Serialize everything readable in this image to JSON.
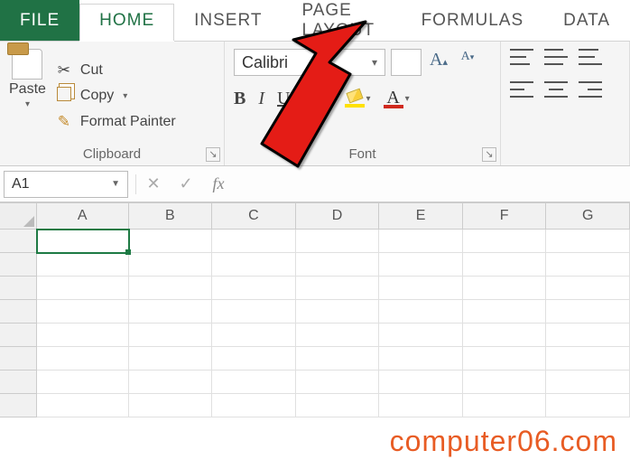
{
  "tabs": {
    "file": "FILE",
    "home": "HOME",
    "insert": "INSERT",
    "page_layout": "PAGE LAYOUT",
    "formulas": "FORMULAS",
    "data": "DATA"
  },
  "clipboard": {
    "paste": "Paste",
    "cut": "Cut",
    "copy": "Copy",
    "format_painter": "Format Painter",
    "group_label": "Clipboard"
  },
  "font": {
    "name": "Calibri",
    "size": "",
    "group_label": "Font"
  },
  "namebox": {
    "value": "A1"
  },
  "fx_label": "fx",
  "columns": [
    "A",
    "B",
    "C",
    "D",
    "E",
    "F",
    "G"
  ],
  "row_count": 8,
  "selected": {
    "col": "A",
    "row": 1
  },
  "watermark": "computer06.com"
}
